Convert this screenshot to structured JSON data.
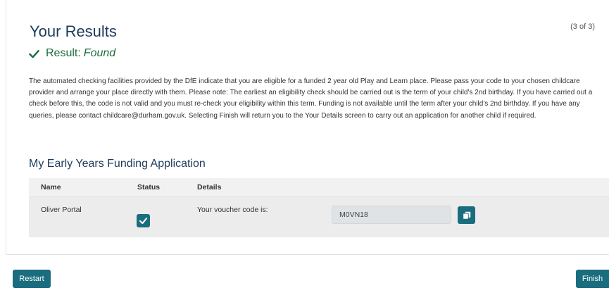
{
  "header": {
    "title": "Your Results",
    "step": "(3 of 3)"
  },
  "result": {
    "label": "Result:",
    "value": "Found"
  },
  "message": "The automated checking facilities provided by the DfE indicate that you are eligible for a funded 2 year old Play and Learn place. Please pass your code to your chosen childcare provider and arrange your place directly with them. Please note: The earliest an eligibility check should be carried out is the term of your child's 2nd birthday. If you have carried out a check before this, the code is not valid and you must re-check your eligibility within this term. Funding is not available until the term after your child's 2nd birthday. If you have any queries, please contact childcare@durham.gov.uk. Selecting Finish will return you to the Your Details screen to carry out an application for another child if required.",
  "application": {
    "title": "My Early Years Funding Application",
    "columns": {
      "name": "Name",
      "status": "Status",
      "details": "Details"
    },
    "rows": [
      {
        "name": "Oliver Portal",
        "status_checked": true,
        "details_label": "Your voucher code is:",
        "voucher_code": "M0VN18"
      }
    ]
  },
  "footer": {
    "restart_label": "Restart",
    "finish_label": "Finish"
  },
  "colors": {
    "accent": "#1a6d7f",
    "heading": "#1d3c5c",
    "success": "#1c6e3c"
  },
  "icons": {
    "result": "checkmark-icon",
    "status": "checkbox-checked-icon",
    "copy": "copy-icon"
  }
}
